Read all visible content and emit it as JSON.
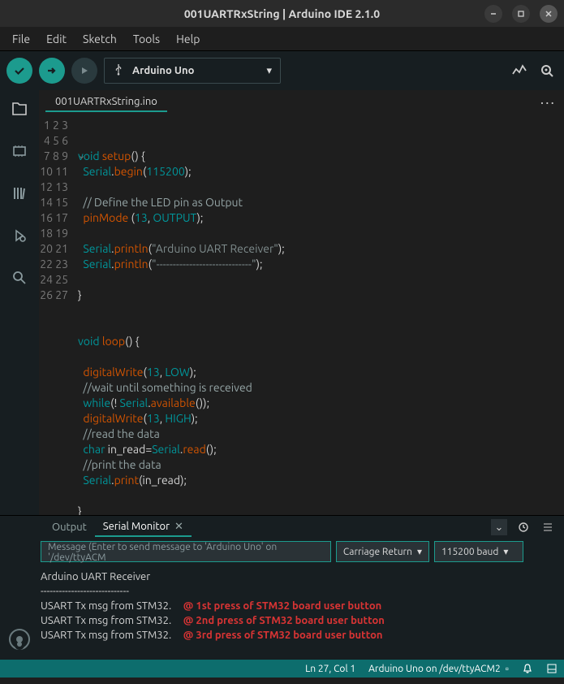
{
  "window": {
    "title": "001UARTRxString | Arduino IDE 2.1.0"
  },
  "menu": [
    "File",
    "Edit",
    "Sketch",
    "Tools",
    "Help"
  ],
  "board": {
    "label": "Arduino Uno"
  },
  "tab": {
    "name": "001UARTRxString.ino"
  },
  "code_lines": [
    "",
    "",
    "void setup() {",
    "  Serial.begin(115200);",
    "",
    "  // Define the LED pin as Output",
    "  pinMode (13, OUTPUT);",
    "",
    "  Serial.println(\"Arduino UART Receiver\");",
    "  Serial.println(\"-----------------------------\");",
    "",
    "}",
    "",
    "",
    "void loop() {",
    "",
    "  digitalWrite(13, LOW);",
    "  //wait until something is received",
    "  while(! Serial.available());",
    "  digitalWrite(13, HIGH);",
    "  //read the data",
    "  char in_read=Serial.read();",
    "  //print the data",
    "  Serial.print(in_read);",
    "",
    "}",
    ""
  ],
  "panel": {
    "tabs": {
      "output": "Output",
      "serial": "Serial Monitor"
    },
    "msg_placeholder": "Message (Enter to send message to 'Arduino Uno' on '/dev/ttyACM",
    "lineend": "Carriage Return",
    "baud": "115200 baud"
  },
  "serial_out": {
    "l1": "Arduino UART Receiver",
    "l2": "-----------------------------",
    "l3": "USART Tx msg from STM32.",
    "l4": "USART Tx msg from STM32.",
    "l5": "USART Tx msg from STM32.",
    "a1": "@ 1st press of STM32 board user button",
    "a2": "@ 2nd press of STM32 board user button",
    "a3": "@ 3rd press of STM32 board user button"
  },
  "status": {
    "pos": "Ln 27, Col 1",
    "board": "Arduino Uno on /dev/ttyACM2"
  }
}
